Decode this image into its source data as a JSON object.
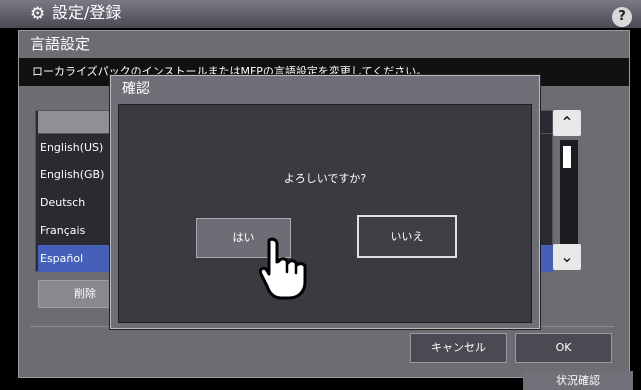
{
  "header": {
    "gear_icon": "gear-icon",
    "title": "設定/登録",
    "help_label": "?"
  },
  "panel": {
    "title": "言語設定",
    "description": "ローカライズパックのインストールまたはMFPの言語設定を変更してください。"
  },
  "languages": {
    "items": [
      {
        "label": "English(US)",
        "selected": false
      },
      {
        "label": "English(GB)",
        "selected": false
      },
      {
        "label": "Deutsch",
        "selected": false
      },
      {
        "label": "Français",
        "selected": false
      },
      {
        "label": "Español",
        "selected": true
      }
    ],
    "scroll_up_icon": "chevron-up-icon",
    "scroll_down_icon": "chevron-down-icon"
  },
  "buttons": {
    "delete": "削除",
    "cancel": "キャンセル",
    "ok": "OK",
    "status": "状況確認"
  },
  "dialog": {
    "title": "確認",
    "question": "よろしいですか?",
    "yes": "はい",
    "no": "いいえ"
  },
  "colors": {
    "selected_row": "#4560b8",
    "panel": "#6c6c73",
    "dialog_inner": "#3a3a40"
  }
}
